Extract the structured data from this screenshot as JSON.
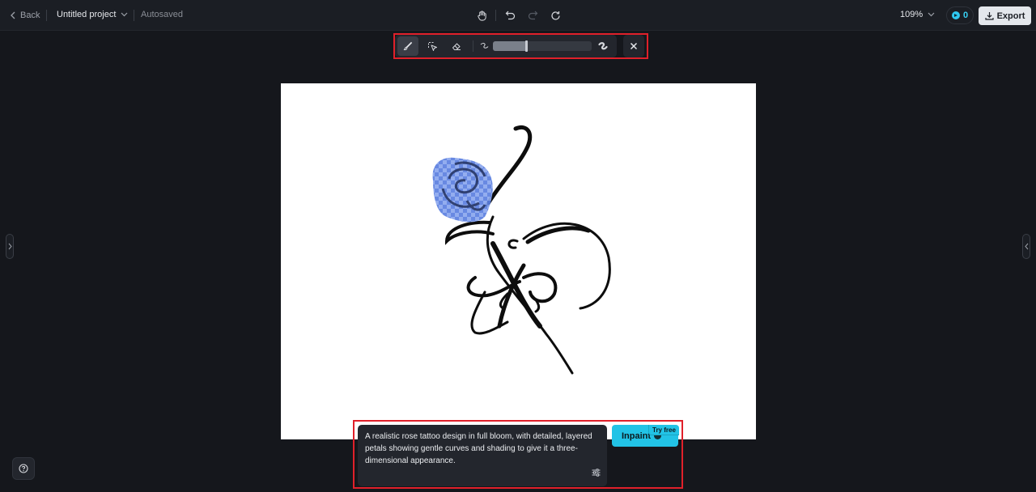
{
  "header": {
    "back_label": "Back",
    "project_title": "Untitled project",
    "autosaved": "Autosaved",
    "zoom": "109%",
    "credits": "0",
    "export_label": "Export"
  },
  "brush_toolbar": {
    "active_tool": "brush",
    "brush_size": 0.34
  },
  "prompt": {
    "text": "A realistic rose tattoo design in full bloom, with detailed, layered petals showing gentle curves and shading to give it a three-dimensional appearance."
  },
  "inpaint": {
    "label": "Inpaint",
    "badge": "Try free"
  },
  "colors": {
    "accent": "#22c3e6",
    "highlight": "#e0202a",
    "mask": "#5b7fe0"
  }
}
